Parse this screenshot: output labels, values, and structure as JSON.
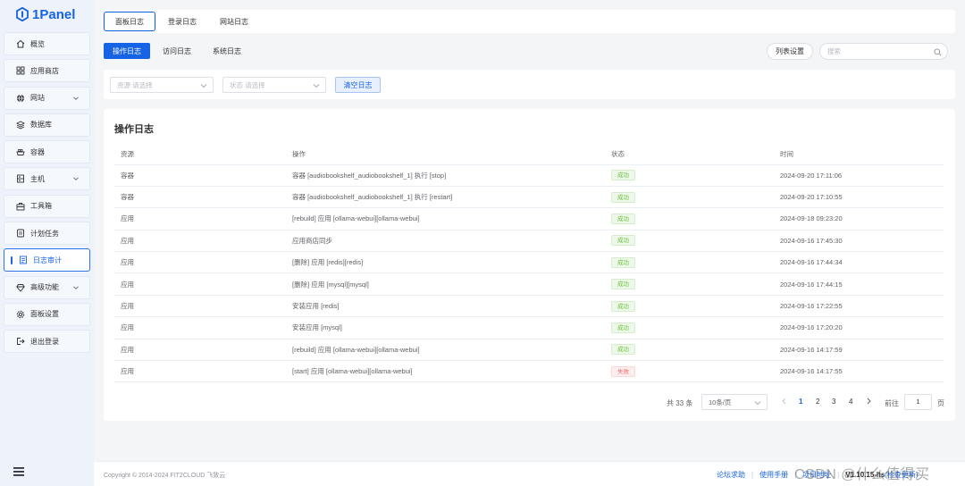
{
  "app": {
    "logo_text": "1Panel"
  },
  "sidebar": {
    "items": [
      {
        "label": "概览",
        "icon": "home-icon",
        "has_submenu": false
      },
      {
        "label": "应用商店",
        "icon": "grid-icon",
        "has_submenu": false
      },
      {
        "label": "网站",
        "icon": "globe-icon",
        "has_submenu": true
      },
      {
        "label": "数据库",
        "icon": "database-icon",
        "has_submenu": false
      },
      {
        "label": "容器",
        "icon": "container-icon",
        "has_submenu": false
      },
      {
        "label": "主机",
        "icon": "server-icon",
        "has_submenu": true
      },
      {
        "label": "工具箱",
        "icon": "toolbox-icon",
        "has_submenu": false
      },
      {
        "label": "计划任务",
        "icon": "schedule-icon",
        "has_submenu": false
      },
      {
        "label": "日志审计",
        "icon": "log-icon",
        "has_submenu": false,
        "active": true
      },
      {
        "label": "高级功能",
        "icon": "diamond-icon",
        "has_submenu": true
      },
      {
        "label": "面板设置",
        "icon": "gear-icon",
        "has_submenu": false
      },
      {
        "label": "退出登录",
        "icon": "logout-icon",
        "has_submenu": false
      }
    ]
  },
  "tabs": [
    "面板日志",
    "登录日志",
    "网站日志"
  ],
  "subtabs": [
    "操作日志",
    "访问日志",
    "系统日志"
  ],
  "toolbar": {
    "column_settings_label": "列表设置",
    "search_placeholder": "搜索"
  },
  "filters": {
    "resource": {
      "label": "资源",
      "placeholder": "请选择"
    },
    "status": {
      "label": "状态",
      "placeholder": "请选择"
    },
    "clear_button_label": "清空日志"
  },
  "card": {
    "title": "操作日志",
    "columns": [
      "资源",
      "操作",
      "状态",
      "时间"
    ],
    "rows": [
      {
        "resource": "容器",
        "operation": "容器 [audiobookshelf_audiobookshelf_1] 执行 [stop]",
        "status": "成功",
        "status_type": "ok",
        "time": "2024-09-20 17:11:06"
      },
      {
        "resource": "容器",
        "operation": "容器 [audiobookshelf_audiobookshelf_1] 执行 [restart]",
        "status": "成功",
        "status_type": "ok",
        "time": "2024-09-20 17:10:55"
      },
      {
        "resource": "应用",
        "operation": "[rebuild] 应用 [ollama-webui][ollama-webui]",
        "status": "成功",
        "status_type": "ok",
        "time": "2024-09-18 09:23:20"
      },
      {
        "resource": "应用",
        "operation": "应用商店同步",
        "status": "成功",
        "status_type": "ok",
        "time": "2024-09-16 17:45:30"
      },
      {
        "resource": "应用",
        "operation": "[删除] 应用 [redis][redis]",
        "status": "成功",
        "status_type": "ok",
        "time": "2024-09-16 17:44:34"
      },
      {
        "resource": "应用",
        "operation": "[删除] 应用 [mysql][mysql]",
        "status": "成功",
        "status_type": "ok",
        "time": "2024-09-16 17:44:15"
      },
      {
        "resource": "应用",
        "operation": "安装应用 [redis]",
        "status": "成功",
        "status_type": "ok",
        "time": "2024-09-16 17:22:55"
      },
      {
        "resource": "应用",
        "operation": "安装应用 [mysql]",
        "status": "成功",
        "status_type": "ok",
        "time": "2024-09-16 17:20:20"
      },
      {
        "resource": "应用",
        "operation": "[rebuild] 应用 [ollama-webui][ollama-webui]",
        "status": "成功",
        "status_type": "ok",
        "time": "2024-09-16 14:17:59"
      },
      {
        "resource": "应用",
        "operation": "[start] 应用 [ollama-webui][ollama-webui]",
        "status": "失败",
        "status_type": "fail",
        "time": "2024-09-16 14:17:55"
      }
    ]
  },
  "pagination": {
    "total_text": "共 33 条",
    "page_size": "10条/页",
    "pages": [
      "1",
      "2",
      "3",
      "4"
    ],
    "current_page": "1",
    "goto_label": "前往",
    "goto_value": "1",
    "page_suffix": "页"
  },
  "footer": {
    "copyright": "Copyright © 2014-2024 FIT2CLOUD 飞致云",
    "links": [
      "论坛求助",
      "使用手册",
      "项目地址"
    ],
    "version_text": "V1.10.15-lts",
    "check_update": "(检查更新)"
  },
  "watermark": "CSDN @什么值得买",
  "colors": {
    "primary": "#1663e6",
    "success": "#67c23a",
    "danger": "#f56c6c"
  }
}
